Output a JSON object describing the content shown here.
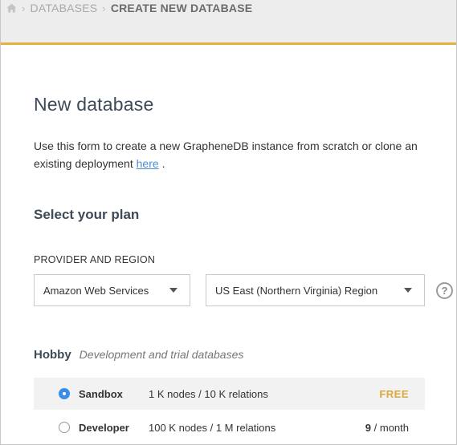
{
  "breadcrumb": {
    "items": [
      "DATABASES"
    ],
    "current": "CREATE NEW DATABASE"
  },
  "page": {
    "title": "New database",
    "intro_text": "Use this form to create a new GrapheneDB instance from scratch or clone an existing deployment",
    "intro_link": "here",
    "intro_end": "."
  },
  "plan_section": {
    "title": "Select your plan",
    "provider_label": "PROVIDER AND REGION",
    "provider_value": "Amazon Web Services",
    "region_value": "US East (Northern Virginia) Region",
    "help_glyph": "?"
  },
  "tier": {
    "name": "Hobby",
    "description": "Development and trial databases"
  },
  "plans": [
    {
      "name": "Sandbox",
      "spec": "1 K nodes / 10 K relations",
      "price": "FREE",
      "selected": true
    },
    {
      "name": "Developer",
      "spec": "100 K nodes / 1 M relations",
      "price_amount": "9",
      "price_unit": " / month",
      "selected": false
    }
  ],
  "colors": {
    "accent_bar": "#e3b23c",
    "radio_selected": "#3a8ee6",
    "free_badge": "#d9a93b",
    "link": "#4a8fd1"
  },
  "icons": [
    "home-icon",
    "chevron-right-icon",
    "chevron-down-icon",
    "help-icon"
  ]
}
